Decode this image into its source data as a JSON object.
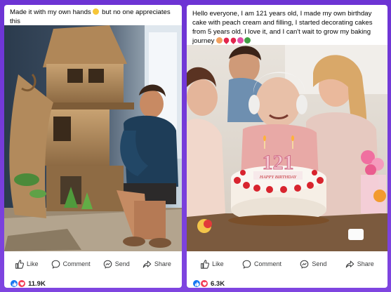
{
  "posts": [
    {
      "caption_text": "Made it with my own hands",
      "caption_text_2": "but no one appreciates this",
      "actions": {
        "like": "Like",
        "comment": "Comment",
        "send": "Send",
        "share": "Share"
      },
      "reaction_count": "11.9K",
      "icons": [
        "like-icon",
        "comment-icon",
        "send-icon",
        "share-icon",
        "like-reaction-icon",
        "love-reaction-icon"
      ]
    },
    {
      "caption_text": "Hello everyone, I am 121 years old, I made my own birthday cake with peach cream and filling, I started decorating cakes from 5 years old, I love it, and I can't wait to grow my baking journey",
      "cake_number": "121",
      "cake_banner": "HAPPY BIRTHDAY",
      "actions": {
        "like": "Like",
        "comment": "Comment",
        "send": "Send",
        "share": "Share"
      },
      "reaction_count": "6.3K",
      "icons": [
        "like-icon",
        "comment-icon",
        "send-icon",
        "share-icon",
        "like-reaction-icon",
        "love-reaction-icon"
      ]
    }
  ],
  "colors": {
    "frame": "#7a3fd6",
    "like": "#1877f2",
    "love": "#f33e58"
  }
}
